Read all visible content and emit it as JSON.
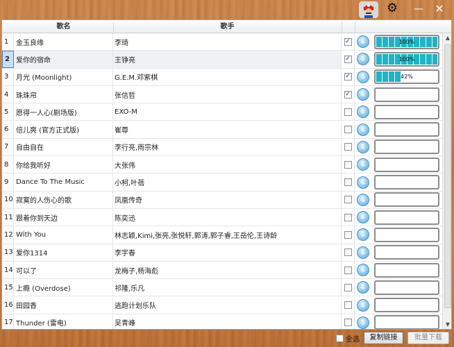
{
  "colors": {
    "progress_fill": "#1fb3c6",
    "selected_row": "#c9dff5",
    "accent_download": "#5aa8dc"
  },
  "window": {
    "avatar_icon": "mario-avatar-icon",
    "settings_icon": "⚙",
    "minimize_icon": "—",
    "close_icon": "✕"
  },
  "table": {
    "headers": {
      "name": "歌名",
      "artist": "歌手"
    },
    "rows": [
      {
        "num": "1",
        "name": "金玉良缘",
        "artist": "李琦",
        "checked": true,
        "progress": 100,
        "progress_text": "100%"
      },
      {
        "num": "2",
        "name": "爱你的宿命",
        "artist": "王铮亮",
        "checked": true,
        "progress": 100,
        "progress_text": "100%"
      },
      {
        "num": "3",
        "name": "月光 (Moonlight)",
        "artist": "G.E.M.邓紫棋",
        "checked": true,
        "progress": 42,
        "progress_text": "42%"
      },
      {
        "num": "4",
        "name": "珠珠帘",
        "artist": "张信哲",
        "checked": true,
        "progress": 0,
        "progress_text": ""
      },
      {
        "num": "5",
        "name": "愿得一人心(剧场版)",
        "artist": "EXO-M",
        "checked": false,
        "progress": 0,
        "progress_text": ""
      },
      {
        "num": "6",
        "name": "倍儿爽 (官方正式版)",
        "artist": "崔尊",
        "checked": false,
        "progress": 0,
        "progress_text": ""
      },
      {
        "num": "7",
        "name": "自由自在",
        "artist": "李行亮,雨宗林",
        "checked": false,
        "progress": 0,
        "progress_text": ""
      },
      {
        "num": "8",
        "name": "你给我听好",
        "artist": "大张伟",
        "checked": false,
        "progress": 0,
        "progress_text": ""
      },
      {
        "num": "9",
        "name": "Dance To The Music",
        "artist": "小柯,叶蓓",
        "checked": false,
        "progress": 0,
        "progress_text": ""
      },
      {
        "num": "10",
        "name": "寂寞的人伤心的歌",
        "artist": "凤凰传奇",
        "checked": false,
        "progress": 0,
        "progress_text": ""
      },
      {
        "num": "11",
        "name": "跟着你到天边",
        "artist": "陈奕迅",
        "checked": false,
        "progress": 0,
        "progress_text": ""
      },
      {
        "num": "12",
        "name": "With You",
        "artist": "林志颖,Kimi,张亮,张悦轩,郭涛,郭子睿,王岳伦,王诗龄",
        "checked": false,
        "progress": 0,
        "progress_text": ""
      },
      {
        "num": "13",
        "name": "爱你1314",
        "artist": "李宇春",
        "checked": false,
        "progress": 0,
        "progress_text": ""
      },
      {
        "num": "14",
        "name": "可以了",
        "artist": "龙梅子,杨海彪",
        "checked": false,
        "progress": 0,
        "progress_text": ""
      },
      {
        "num": "15",
        "name": "上瘾 (Overdose)",
        "artist": "祁隆,乐凡",
        "checked": false,
        "progress": 0,
        "progress_text": ""
      },
      {
        "num": "16",
        "name": "田园香",
        "artist": "逃跑计划乐队",
        "checked": false,
        "progress": 0,
        "progress_text": ""
      },
      {
        "num": "17",
        "name": "Thunder (雷电)",
        "artist": "吴青峰",
        "checked": false,
        "progress": 0,
        "progress_text": ""
      }
    ]
  },
  "footer": {
    "select_all_label": "全选",
    "copy_link_label": "复制链接",
    "batch_download_label": "批量下载"
  }
}
